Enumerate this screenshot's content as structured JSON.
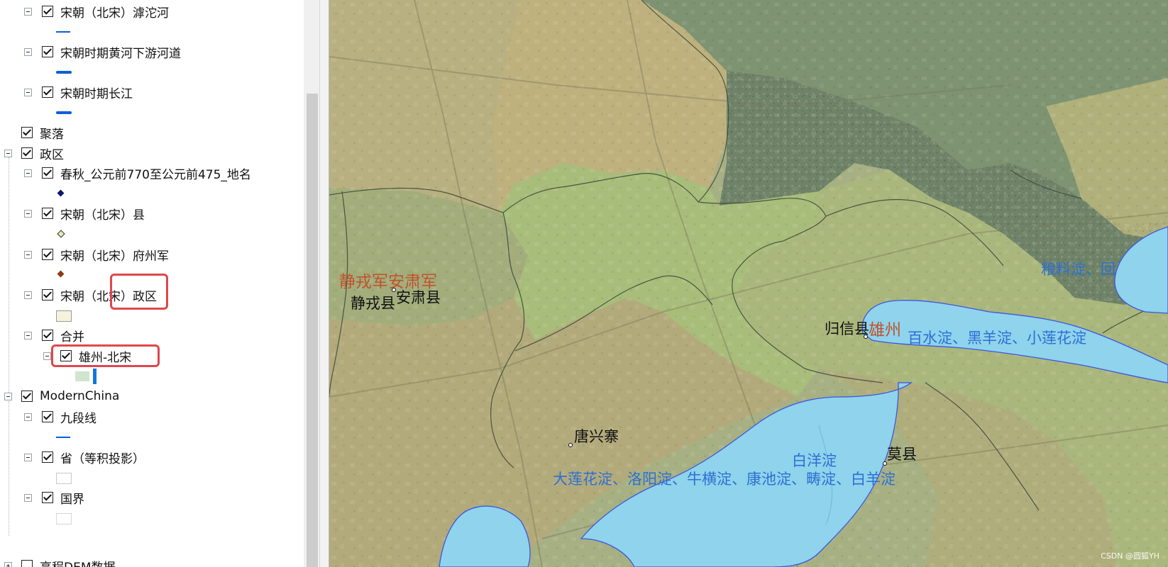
{
  "toc": {
    "layers": [
      {
        "label": "宋朝（北宋）滹沱河"
      },
      {
        "label": "宋朝时期黄河下游河道"
      },
      {
        "label": "宋朝时期长江"
      },
      {
        "label": "聚落"
      },
      {
        "label": "政区"
      },
      {
        "label": "春秋_公元前770至公元前475_地名"
      },
      {
        "label": "宋朝（北宋）县"
      },
      {
        "label": "宋朝（北宋）府州军"
      },
      {
        "label": "宋朝（北宋）政区"
      },
      {
        "label": "合并"
      },
      {
        "label": "雄州-北宋"
      },
      {
        "label": "ModernChina"
      },
      {
        "label": "九段线"
      },
      {
        "label": "省（等积投影）"
      },
      {
        "label": "国界"
      },
      {
        "label": "高程DEM数据"
      }
    ],
    "colors": {
      "river_line": "#0b5ed7",
      "settlement_point": "#0b1a6e",
      "county_point": "#e9e9b8",
      "prefecture_point": "#8b3a12",
      "region_fill": "#f7f2dc",
      "merge_fill": "#cfe5cf",
      "merge_bar": "#1177dd",
      "highlight": "#e0474c"
    }
  },
  "map": {
    "labels": {
      "jingrongjun_anshujun": "静戎军安肃军",
      "jingrong_county": "静戎县",
      "anshu_county": "安肃县",
      "guixin_county": "归信县",
      "xiongzhou": "雄州",
      "baishui_lakes": "百水淀、黑羊淀、小莲花淀",
      "liangliao_lakes": "粮料淀、回",
      "tangxingzhai": "唐兴寨",
      "baiyang_lake": "白洋淀",
      "mo_county": "莫县",
      "dalianhua_lakes": "大莲花淀、洛阳淀、牛横淀、康池淀、畴淀、白羊淀"
    },
    "colors": {
      "lake_fill": "#8fd3ec",
      "lake_edge": "#3d56e0",
      "county_label": "#111111",
      "prefecture_label": "#c0522c",
      "lake_label": "#2d6fd3"
    },
    "watermark": "CSDN @圆狐YH"
  }
}
